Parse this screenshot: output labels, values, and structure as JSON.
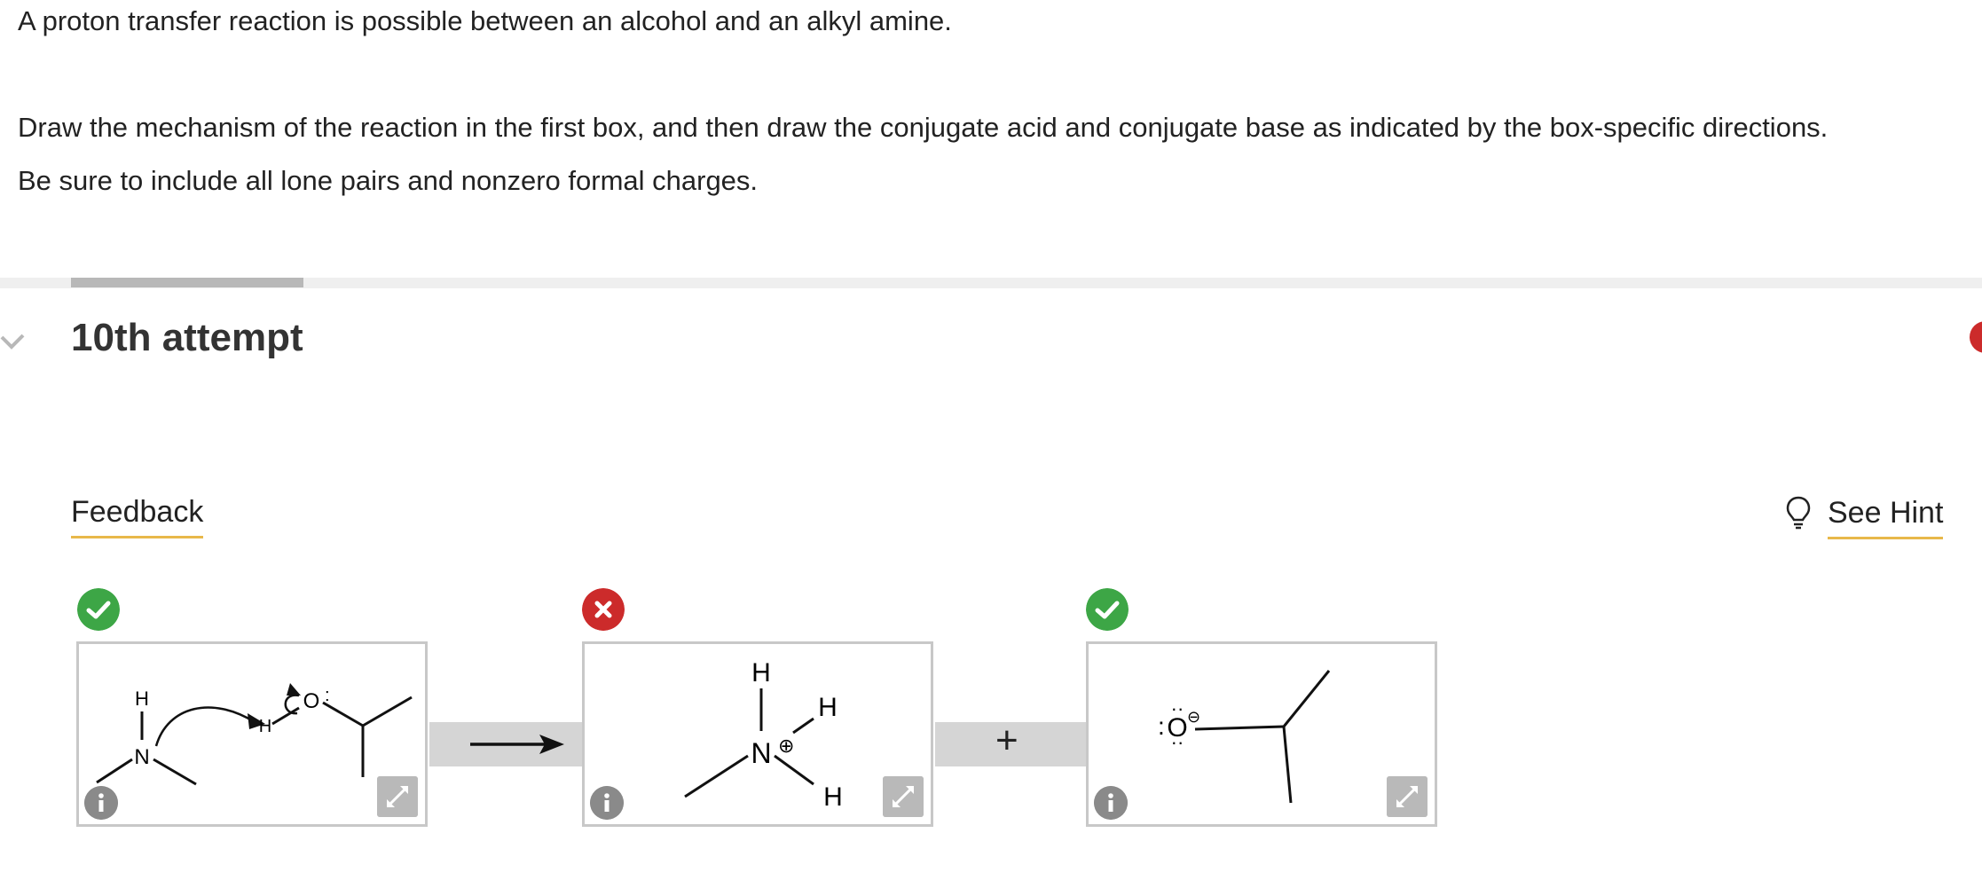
{
  "question": {
    "line1": "A proton transfer reaction is possible between an alcohol and an alkyl amine.",
    "line2": "Draw the mechanism of the reaction in the first box, and then draw the conjugate acid and conjugate base as indicated by the box-specific directions.",
    "line3": "Be sure to include all lone pairs and nonzero formal charges."
  },
  "attempt": {
    "title": "10th attempt"
  },
  "links": {
    "feedback": "Feedback",
    "hint": "See Hint"
  },
  "boxes": [
    {
      "status": "correct",
      "atoms": {
        "h": "H",
        "n": "N",
        "h2": "H",
        "o": "O",
        "lp": ":"
      }
    },
    {
      "status": "incorrect",
      "atoms": {
        "h_top": "H",
        "h_right": "H",
        "n": "N",
        "h_bottom": "H",
        "charge": "⊕"
      }
    },
    {
      "status": "correct",
      "atoms": {
        "o": "O",
        "lp_left": ":",
        "lp_top": "··",
        "lp_bottom": "··",
        "charge": "⊖"
      }
    }
  ],
  "operator": "+",
  "colors": {
    "correct": "#3da646",
    "incorrect": "#cc2b2b",
    "underline": "#e8b84a",
    "icon": "#8a8a8a"
  }
}
